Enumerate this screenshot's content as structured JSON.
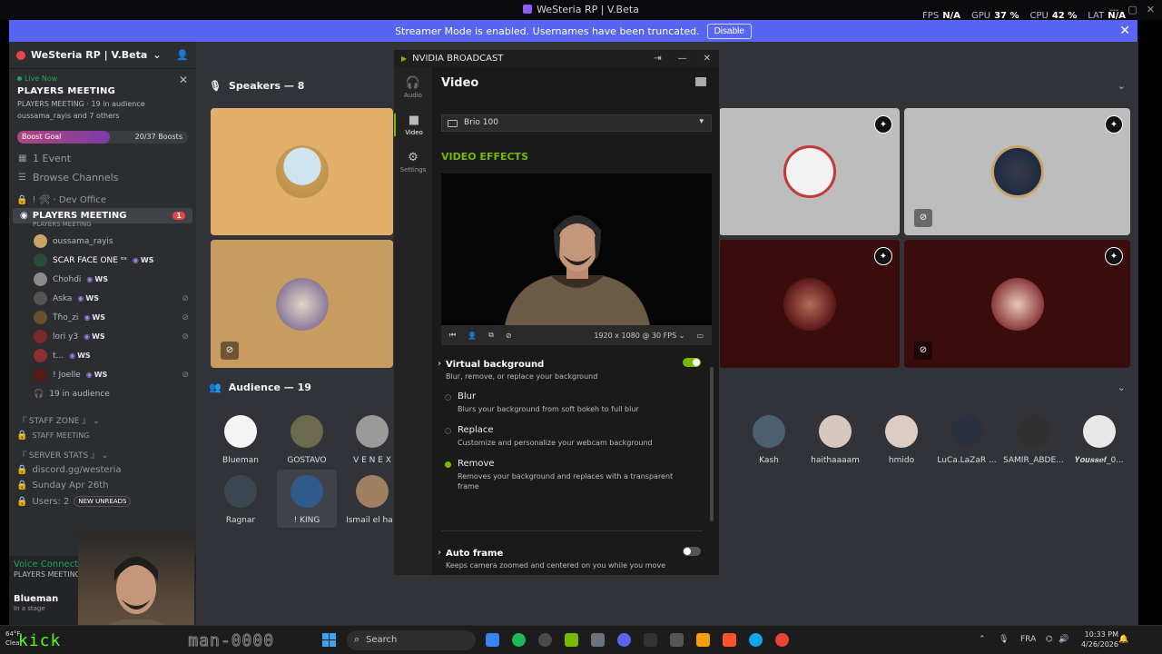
{
  "window": {
    "title": "WeSteria RP | V.Beta",
    "stats": [
      {
        "label": "FPS",
        "value": "N/A"
      },
      {
        "label": "GPU",
        "value": "37 %"
      },
      {
        "label": "CPU",
        "value": "42 %"
      },
      {
        "label": "LAT",
        "value": "N/A"
      }
    ]
  },
  "banner": {
    "text": "Streamer Mode is enabled. Usernames have been truncated.",
    "disable_label": "Disable"
  },
  "server": {
    "name": "WeSteria RP | V.Beta",
    "live_now": "Live Now",
    "live_title": "PLAYERS MEETING",
    "live_sub": "PLAYERS MEETING · 19 in audience",
    "live_people": "oussama_rayis and 7 others",
    "boost_label": "Boost Goal",
    "boost_count": "20/37 Boosts",
    "boost_progress": 0.54,
    "events": "1 Event",
    "browse": "Browse Channels",
    "dev_office": "! 🛠 · Dev Office",
    "active_channel": "PLAYERS MEETING",
    "active_channel_sub": "PLAYERS MEETING",
    "active_badge": "1",
    "users": [
      {
        "name": "oussama_rayis",
        "tag": ""
      },
      {
        "name": "SCAR FACE ONE ᵒˢ",
        "tag": "WS"
      },
      {
        "name": "Chohdi",
        "tag": "WS"
      },
      {
        "name": "Aska",
        "tag": "WS"
      },
      {
        "name": "Ṫɦo_zi",
        "tag": "WS"
      },
      {
        "name": "lori y3",
        "tag": "WS"
      },
      {
        "name": "t...",
        "tag": "WS"
      },
      {
        "name": "! Joelle",
        "tag": "WS"
      }
    ],
    "in_audience": "19 in audience",
    "staff_zone": "『 STAFF ZONE 』",
    "staff_meeting": "STAFF MEETING",
    "server_stats": "『 SERVER STATS 』",
    "discord_link": "discord.gg/westeria",
    "date": "Sunday Apr 26th",
    "users_count": "Users: 2",
    "new_unreads": "NEW UNREADS"
  },
  "voice": {
    "connected": "Voice Connected",
    "channel": "PLAYERS MEETING / WeSte",
    "user": "Blueman",
    "status": "In a stage"
  },
  "stage": {
    "speakers_label": "Speakers — 8",
    "audience_label": "Audience — 19",
    "audience": [
      {
        "name": "Blueman",
        "color": "#f4f4f4"
      },
      {
        "name": "GOSTAVO",
        "color": "#6b6a4f"
      },
      {
        "name": "V E N E X",
        "color": "#9a9a9a"
      },
      {
        "name": "Ragnar",
        "color": "#3a4650"
      },
      {
        "name": "! KING",
        "color": "#2e5b8a"
      },
      {
        "name": "Ismail el hari",
        "color": "#a08060"
      },
      {
        "name": "Kash",
        "color": "#4a6070"
      },
      {
        "name": "haithaaaam",
        "color": "#d8c8c0"
      },
      {
        "name": "hmido",
        "color": "#dcccc4"
      },
      {
        "name": "LuCa.LaZaR ...",
        "color": "#2a3040"
      },
      {
        "name": "SAMIR_ABDE...",
        "color": "#303030"
      },
      {
        "name": "𝒀𝒐𝒖𝒔𝒔𝒆𝒇_0...",
        "color": "#e8e8e8"
      }
    ]
  },
  "nvidia": {
    "app_title": "NVIDIA BROADCAST",
    "tabs": [
      "Audio",
      "Video",
      "Settings"
    ],
    "page_title": "Video",
    "device": "Brio 100",
    "effects_heading": "VIDEO EFFECTS",
    "resolution": "1920 x 1080 @ 30 FPS",
    "virtual_bg": {
      "title": "Virtual background",
      "desc": "Blur, remove, or replace your background",
      "enabled": true
    },
    "options": [
      {
        "label": "Blur",
        "desc": "Blurs your background from soft bokeh to full blur",
        "selected": false
      },
      {
        "label": "Replace",
        "desc": "Customize and personalize your webcam background",
        "selected": false
      },
      {
        "label": "Remove",
        "desc": "Removes your background and replaces with a transparent frame",
        "selected": true
      }
    ],
    "auto_frame": {
      "title": "Auto frame",
      "desc": "Keeps camera zoomed and centered on you while you move",
      "enabled": false
    }
  },
  "taskbar": {
    "weather_temp": "64°F",
    "weather_desc": "Clea",
    "overlay_text": "kick",
    "overlay_tail": "man-0000",
    "search": "Search",
    "lang": "FRA",
    "time": "10:33 PM",
    "date": "4/26/2026"
  }
}
